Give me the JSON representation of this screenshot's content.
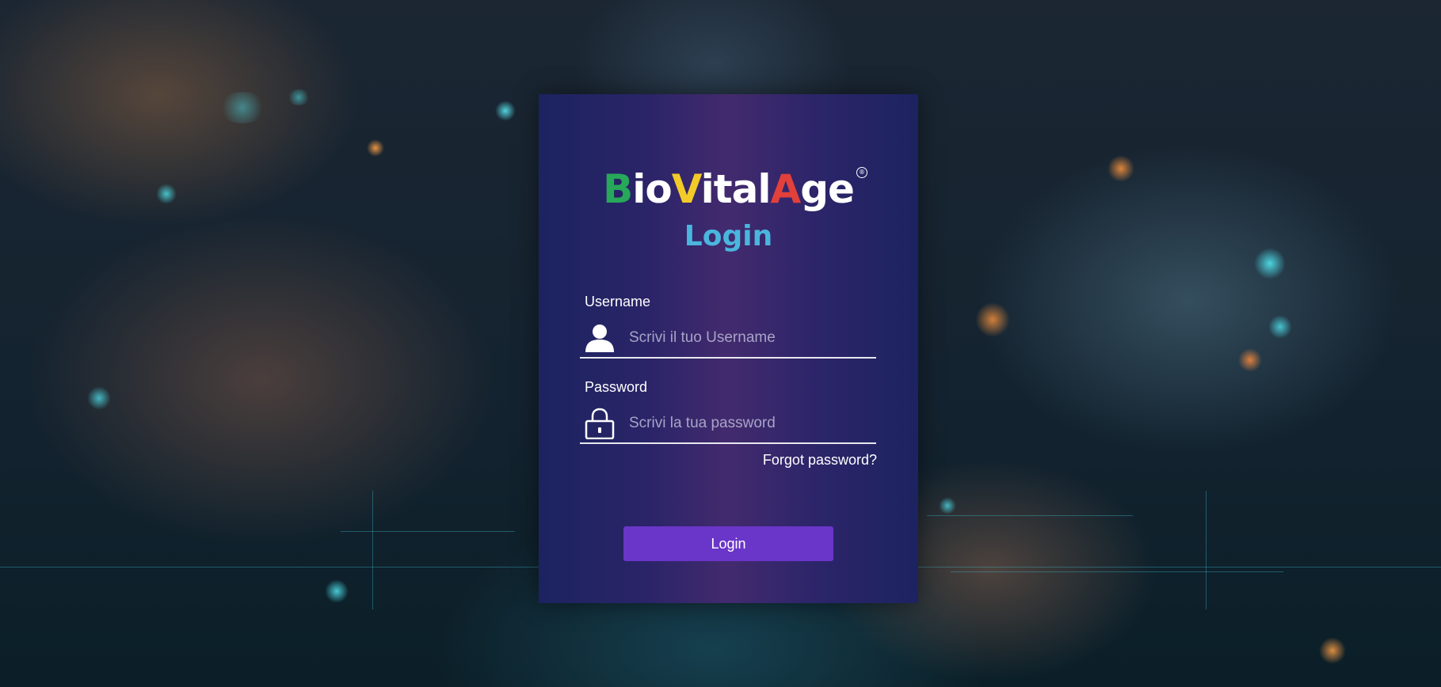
{
  "brand": {
    "logo_parts": [
      "B",
      "io",
      "V",
      "ital",
      "A",
      "ge"
    ],
    "registered_mark": "®",
    "colors": {
      "green": "#27a85a",
      "yellow": "#f3cb28",
      "red": "#e2403b",
      "title_blue": "#4ab6de",
      "button_purple": "#6a35c9"
    }
  },
  "form": {
    "title": "Login",
    "username": {
      "label": "Username",
      "placeholder": "Scrivi il tuo Username",
      "value": "",
      "icon": "user-icon"
    },
    "password": {
      "label": "Password",
      "placeholder": "Scrivi la tua password",
      "value": "",
      "icon": "lock-icon"
    },
    "forgot_password": "Forgot password?",
    "submit_label": "Login"
  }
}
